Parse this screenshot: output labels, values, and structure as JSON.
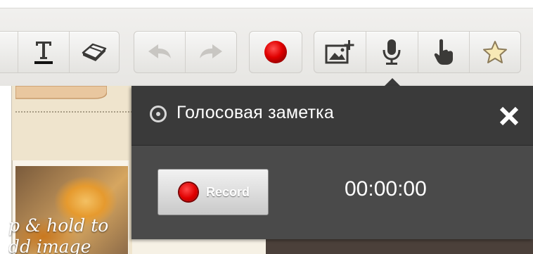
{
  "toolbar": {
    "groups": [
      {
        "name": "format",
        "buttons": [
          "text-tool",
          "eraser-tool"
        ]
      },
      {
        "name": "history",
        "buttons": [
          "undo",
          "redo"
        ]
      },
      {
        "name": "recording",
        "buttons": [
          "record-toggle"
        ]
      },
      {
        "name": "media",
        "buttons": [
          "add-image",
          "voice-note",
          "pointer",
          "favorite"
        ]
      }
    ],
    "record_color": "#e00000",
    "icon_color": "#3b3a38"
  },
  "left_panel": {
    "photo_text": "p & hold to\ndd image"
  },
  "voice_note_popup": {
    "title": "Голосовая заметка",
    "record_label": "Record",
    "timer": "00:00:00",
    "header_color": "#3a3a3a",
    "body_color": "#4a4a4a"
  }
}
